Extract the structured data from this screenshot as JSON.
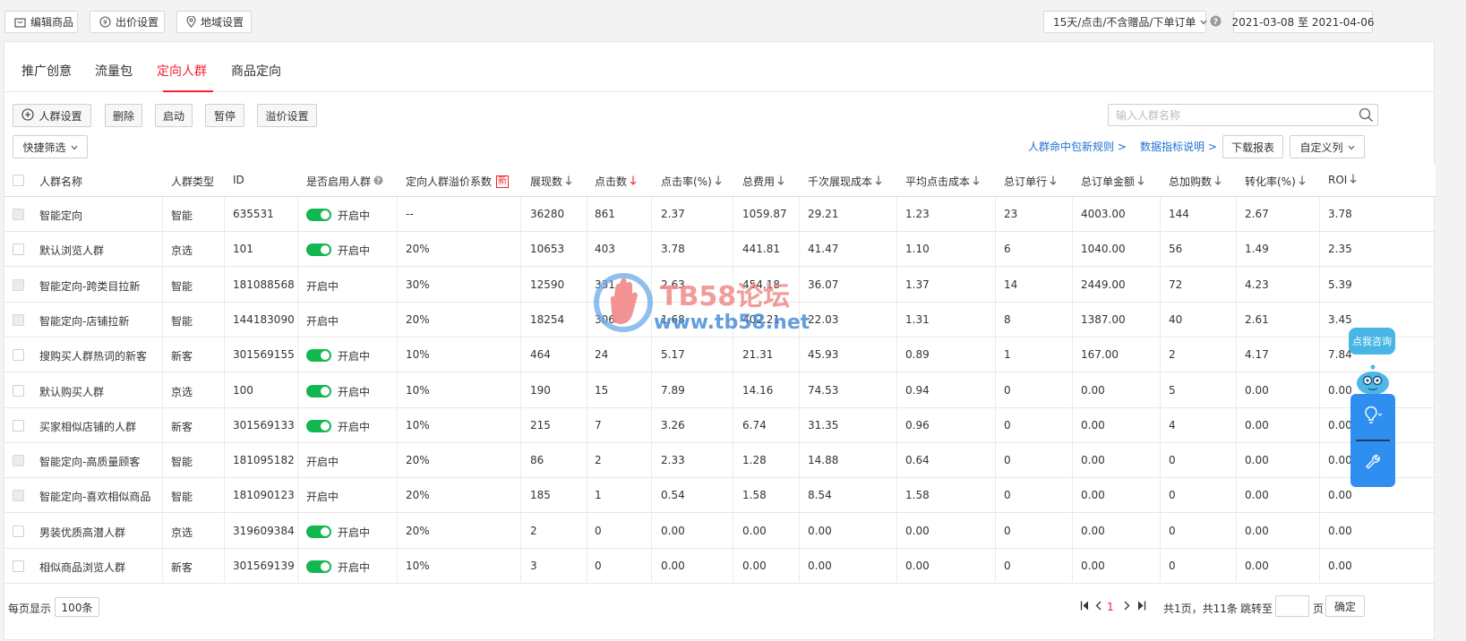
{
  "toolbar": {
    "edit_product": "编辑商品",
    "bid_settings": "出价设置",
    "region_settings": "地域设置",
    "attribution": "15天/点击/不含赠品/下单订单",
    "date_range": "2021-03-08 至 2021-04-06"
  },
  "tabs": [
    "推广创意",
    "流量包",
    "定向人群",
    "商品定向"
  ],
  "actions": {
    "audience_settings": "人群设置",
    "delete": "删除",
    "start": "启动",
    "pause": "暂停",
    "premium_settings": "溢价设置",
    "quick_filter": "快捷筛选"
  },
  "search": {
    "placeholder": "输入人群名称"
  },
  "links": {
    "new_rules": "人群命中包新规则 >",
    "metrics_desc": "数据指标说明 >",
    "download": "下载报表",
    "custom_columns": "自定义列"
  },
  "table": {
    "headers": [
      "人群名称",
      "人群类型",
      "ID",
      "是否启用人群",
      "定向人群溢价系数",
      "展现数",
      "点击数",
      "点击率(%)",
      "总费用",
      "千次展现成本",
      "平均点击成本",
      "总订单行",
      "总订单金额",
      "总加购数",
      "转化率(%)",
      "ROI"
    ],
    "new_badge": "新",
    "rows": [
      {
        "name": "智能定向",
        "type": "智能",
        "id": "635531",
        "status": "开启中",
        "toggle": true,
        "disabled": true,
        "premium": "--",
        "impressions": "36280",
        "clicks": "861",
        "ctr": "2.37",
        "cost": "1059.87",
        "cpm": "29.21",
        "cpc": "1.23",
        "orders": "23",
        "amount": "4003.00",
        "carts": "144",
        "cvr": "2.67",
        "roi": "3.78"
      },
      {
        "name": "默认浏览人群",
        "type": "京选",
        "id": "101",
        "status": "开启中",
        "toggle": true,
        "disabled": false,
        "premium": "20%",
        "impressions": "10653",
        "clicks": "403",
        "ctr": "3.78",
        "cost": "441.81",
        "cpm": "41.47",
        "cpc": "1.10",
        "orders": "6",
        "amount": "1040.00",
        "carts": "56",
        "cvr": "1.49",
        "roi": "2.35"
      },
      {
        "name": "智能定向-跨类目拉新",
        "type": "智能",
        "id": "181088568",
        "status": "开启中",
        "toggle": false,
        "disabled": true,
        "premium": "30%",
        "impressions": "12590",
        "clicks": "331",
        "ctr": "2.63",
        "cost": "454.18",
        "cpm": "36.07",
        "cpc": "1.37",
        "orders": "14",
        "amount": "2449.00",
        "carts": "72",
        "cvr": "4.23",
        "roi": "5.39"
      },
      {
        "name": "智能定向-店铺拉新",
        "type": "智能",
        "id": "144183090",
        "status": "开启中",
        "toggle": false,
        "disabled": true,
        "premium": "20%",
        "impressions": "18254",
        "clicks": "306",
        "ctr": "1.68",
        "cost": "402.21",
        "cpm": "22.03",
        "cpc": "1.31",
        "orders": "8",
        "amount": "1387.00",
        "carts": "40",
        "cvr": "2.61",
        "roi": "3.45"
      },
      {
        "name": "搜购买人群热词的新客",
        "type": "新客",
        "id": "301569155",
        "status": "开启中",
        "toggle": true,
        "disabled": false,
        "premium": "10%",
        "impressions": "464",
        "clicks": "24",
        "ctr": "5.17",
        "cost": "21.31",
        "cpm": "45.93",
        "cpc": "0.89",
        "orders": "1",
        "amount": "167.00",
        "carts": "2",
        "cvr": "4.17",
        "roi": "7.84"
      },
      {
        "name": "默认购买人群",
        "type": "京选",
        "id": "100",
        "status": "开启中",
        "toggle": true,
        "disabled": false,
        "premium": "10%",
        "impressions": "190",
        "clicks": "15",
        "ctr": "7.89",
        "cost": "14.16",
        "cpm": "74.53",
        "cpc": "0.94",
        "orders": "0",
        "amount": "0.00",
        "carts": "5",
        "cvr": "0.00",
        "roi": "0.00"
      },
      {
        "name": "买家相似店铺的人群",
        "type": "新客",
        "id": "301569133",
        "status": "开启中",
        "toggle": true,
        "disabled": false,
        "premium": "10%",
        "impressions": "215",
        "clicks": "7",
        "ctr": "3.26",
        "cost": "6.74",
        "cpm": "31.35",
        "cpc": "0.96",
        "orders": "0",
        "amount": "0.00",
        "carts": "4",
        "cvr": "0.00",
        "roi": "0.00"
      },
      {
        "name": "智能定向-高质量顾客",
        "type": "智能",
        "id": "181095182",
        "status": "开启中",
        "toggle": false,
        "disabled": true,
        "premium": "20%",
        "impressions": "86",
        "clicks": "2",
        "ctr": "2.33",
        "cost": "1.28",
        "cpm": "14.88",
        "cpc": "0.64",
        "orders": "0",
        "amount": "0.00",
        "carts": "0",
        "cvr": "0.00",
        "roi": "0.00"
      },
      {
        "name": "智能定向-喜欢相似商品",
        "type": "智能",
        "id": "181090123",
        "status": "开启中",
        "toggle": false,
        "disabled": true,
        "premium": "20%",
        "impressions": "185",
        "clicks": "1",
        "ctr": "0.54",
        "cost": "1.58",
        "cpm": "8.54",
        "cpc": "1.58",
        "orders": "0",
        "amount": "0.00",
        "carts": "0",
        "cvr": "0.00",
        "roi": "0.00"
      },
      {
        "name": "男装优质高潜人群",
        "type": "京选",
        "id": "319609384",
        "status": "开启中",
        "toggle": true,
        "disabled": false,
        "premium": "20%",
        "impressions": "2",
        "clicks": "0",
        "ctr": "0.00",
        "cost": "0.00",
        "cpm": "0.00",
        "cpc": "0.00",
        "orders": "0",
        "amount": "0.00",
        "carts": "0",
        "cvr": "0.00",
        "roi": "0.00"
      },
      {
        "name": "相似商品浏览人群",
        "type": "新客",
        "id": "301569139",
        "status": "开启中",
        "toggle": true,
        "disabled": false,
        "premium": "10%",
        "impressions": "3",
        "clicks": "0",
        "ctr": "0.00",
        "cost": "0.00",
        "cpm": "0.00",
        "cpc": "0.00",
        "orders": "0",
        "amount": "0.00",
        "carts": "0",
        "cvr": "0.00",
        "roi": "0.00"
      }
    ]
  },
  "footer": {
    "per_page_label": "每页显示",
    "per_page_value": "100条",
    "current_page": "1",
    "summary": "共1页，共11条",
    "jump_label": "跳转至",
    "page_unit": "页",
    "confirm": "确定"
  },
  "watermark": {
    "title": "TB58论坛",
    "url": "www.tb58.net"
  },
  "widget": {
    "consult": "点我咨询"
  },
  "colors": {
    "accent": "#f5222d",
    "link": "#1f6fd1",
    "toggle_on": "#12b84f",
    "widget": "#2f8ff0"
  }
}
